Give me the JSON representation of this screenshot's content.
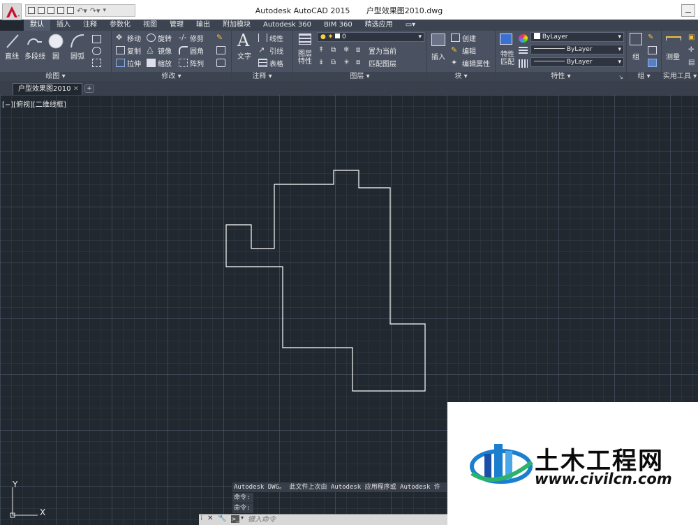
{
  "window": {
    "app_title": "Autodesk AutoCAD 2015",
    "file_name": "户型效果图2010.dwg"
  },
  "ribbon_tabs": [
    "默认",
    "插入",
    "注释",
    "参数化",
    "视图",
    "管理",
    "输出",
    "附加模块",
    "Autodesk 360",
    "BIM 360",
    "精选应用",
    "▭▾"
  ],
  "panels": {
    "draw": {
      "title": "绘图 ▾",
      "line": "直线",
      "polyline": "多段线",
      "circle": "圆",
      "arc": "圆弧"
    },
    "modify": {
      "title": "修改 ▾",
      "move": "移动",
      "rotate": "旋转",
      "trim": "修剪",
      "copy": "复制",
      "mirror": "镜像",
      "fillet": "圆角",
      "stretch": "拉伸",
      "scale": "缩放",
      "array": "阵列"
    },
    "annotation": {
      "title": "注释 ▾",
      "text": "文字",
      "linear": "线性",
      "leader": "引线",
      "table": "表格"
    },
    "layers": {
      "title": "图层 ▾",
      "layer_props": "图层\n特性",
      "current_layer": "0",
      "set_current": "置为当前",
      "match_layer": "匹配图层"
    },
    "block": {
      "title": "块 ▾",
      "insert": "插入",
      "create": "创建",
      "edit": "编辑",
      "edit_attr": "编辑属性"
    },
    "properties": {
      "title": "特性 ▾",
      "match": "特性\n匹配",
      "color": "ByLayer",
      "linetype": "ByLayer",
      "lineweight": "ByLayer"
    },
    "groups": {
      "title": "组 ▾",
      "group": "组"
    },
    "utilities": {
      "title": "实用工具 ▾",
      "measure": "测量"
    }
  },
  "document_tab": "户型效果图2010",
  "viewport_label": "[−][俯视][二维线框]",
  "command": {
    "history": [
      "Autodesk DWG。  此文件上次由 Autodesk 应用程序或 Autodesk 许",
      "命令:",
      "命令:"
    ],
    "placeholder": "键入命令"
  },
  "ucs": {
    "x": "X",
    "y": "Y"
  },
  "watermark": {
    "name": "土木工程网",
    "url": "www.civilcn.com"
  },
  "colors": {
    "canvas": "#212830",
    "ribbon": "#4a5262",
    "app_red": "#c8102e"
  }
}
